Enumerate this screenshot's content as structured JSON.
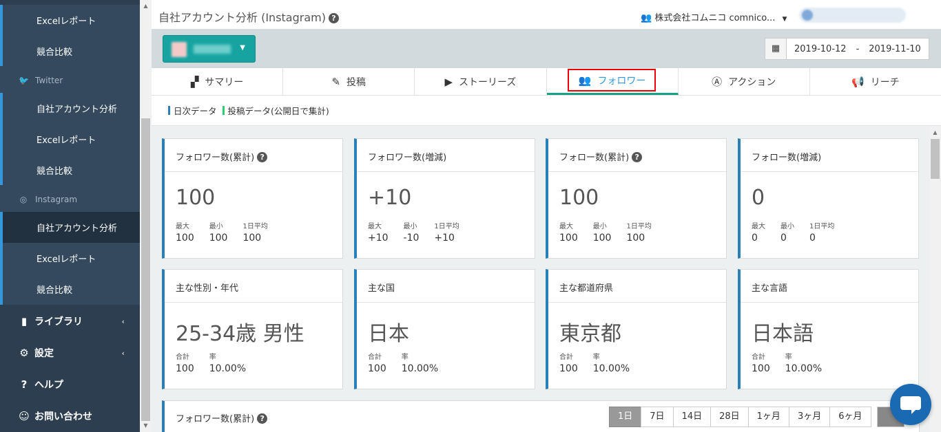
{
  "sidebar": {
    "items": [
      {
        "label": "Excelレポート",
        "kind": "sub"
      },
      {
        "label": "競合比較",
        "kind": "sub"
      },
      {
        "label": "Twitter",
        "kind": "group",
        "icon": "twitter-icon"
      },
      {
        "label": "自社アカウント分析",
        "kind": "sub"
      },
      {
        "label": "Excelレポート",
        "kind": "sub"
      },
      {
        "label": "競合比較",
        "kind": "sub"
      },
      {
        "label": "Instagram",
        "kind": "group",
        "icon": "instagram-icon"
      },
      {
        "label": "自社アカウント分析",
        "kind": "sub",
        "active": true
      },
      {
        "label": "Excelレポート",
        "kind": "sub"
      },
      {
        "label": "競合比較",
        "kind": "sub"
      },
      {
        "label": "ライブラリ",
        "kind": "main",
        "icon": "book-icon"
      },
      {
        "label": "設定",
        "kind": "main",
        "icon": "gear-icon"
      },
      {
        "label": "ヘルプ",
        "kind": "main",
        "icon": "help-icon"
      },
      {
        "label": "お問い合わせ",
        "kind": "main",
        "icon": "chat-icon"
      }
    ]
  },
  "header": {
    "title": "自社アカウント分析 (Instagram)",
    "company": "株式会社コムニコ comnico...",
    "date_from": "2019-10-12",
    "date_sep": "-",
    "date_to": "2019-11-10"
  },
  "tabs": [
    {
      "label": "サマリー",
      "icon": "dashboard-icon"
    },
    {
      "label": "投稿",
      "icon": "edit-post-icon"
    },
    {
      "label": "ストーリーズ",
      "icon": "play-icon"
    },
    {
      "label": "フォロワー",
      "icon": "people-icon",
      "active": true
    },
    {
      "label": "アクション",
      "icon": "action-icon"
    },
    {
      "label": "リーチ",
      "icon": "megaphone-icon"
    }
  ],
  "legend": {
    "daily": "日次データ",
    "daily_color": "#2980b9",
    "posts": "投稿データ(公開日で集計)",
    "posts_color": "#2ecc71"
  },
  "cards_row1": [
    {
      "title": "フォロワー数(累計)",
      "help": true,
      "value": "100",
      "stats": [
        {
          "k": "最大",
          "v": "100"
        },
        {
          "k": "最小",
          "v": "100"
        },
        {
          "k": "1日平均",
          "v": "100"
        }
      ]
    },
    {
      "title": "フォロワー数(増減)",
      "help": false,
      "value": "+10",
      "stats": [
        {
          "k": "最大",
          "v": "+10"
        },
        {
          "k": "最小",
          "v": "-10"
        },
        {
          "k": "1日平均",
          "v": "+10"
        }
      ]
    },
    {
      "title": "フォロー数(累計)",
      "help": true,
      "value": "100",
      "stats": [
        {
          "k": "最大",
          "v": "100"
        },
        {
          "k": "最小",
          "v": "100"
        },
        {
          "k": "1日平均",
          "v": "100"
        }
      ]
    },
    {
      "title": "フォロー数(増減)",
      "help": false,
      "value": "0",
      "stats": [
        {
          "k": "最大",
          "v": "0"
        },
        {
          "k": "最小",
          "v": "0"
        },
        {
          "k": "1日平均",
          "v": "0"
        }
      ]
    }
  ],
  "cards_row2": [
    {
      "title": "主な性別・年代",
      "value": "25-34歳 男性",
      "stats": [
        {
          "k": "合計",
          "v": "100"
        },
        {
          "k": "率",
          "v": "10.00%"
        }
      ]
    },
    {
      "title": "主な国",
      "value": "日本",
      "stats": [
        {
          "k": "合計",
          "v": "100"
        },
        {
          "k": "率",
          "v": "10.00%"
        }
      ]
    },
    {
      "title": "主な都道府県",
      "value": "東京都",
      "stats": [
        {
          "k": "合計",
          "v": "100"
        },
        {
          "k": "率",
          "v": "10.00%"
        }
      ]
    },
    {
      "title": "主な言語",
      "value": "日本語",
      "stats": [
        {
          "k": "合計",
          "v": "100"
        },
        {
          "k": "率",
          "v": "10.00%"
        }
      ]
    }
  ],
  "chart_section": {
    "title": "フォロワー数(累計)",
    "periods": [
      "1日",
      "7日",
      "14日",
      "28日",
      "1ヶ月",
      "3ヶ月",
      "6ヶ月"
    ],
    "selected": "1日"
  },
  "colors": {
    "sidebar_bg": "#2c3e50",
    "accent_blue": "#2980b9",
    "account_button": "#17a4a0",
    "active_tab_underline": "#16a085",
    "highlight_box": "#ee0000",
    "chat_button": "#1a6ab3"
  }
}
